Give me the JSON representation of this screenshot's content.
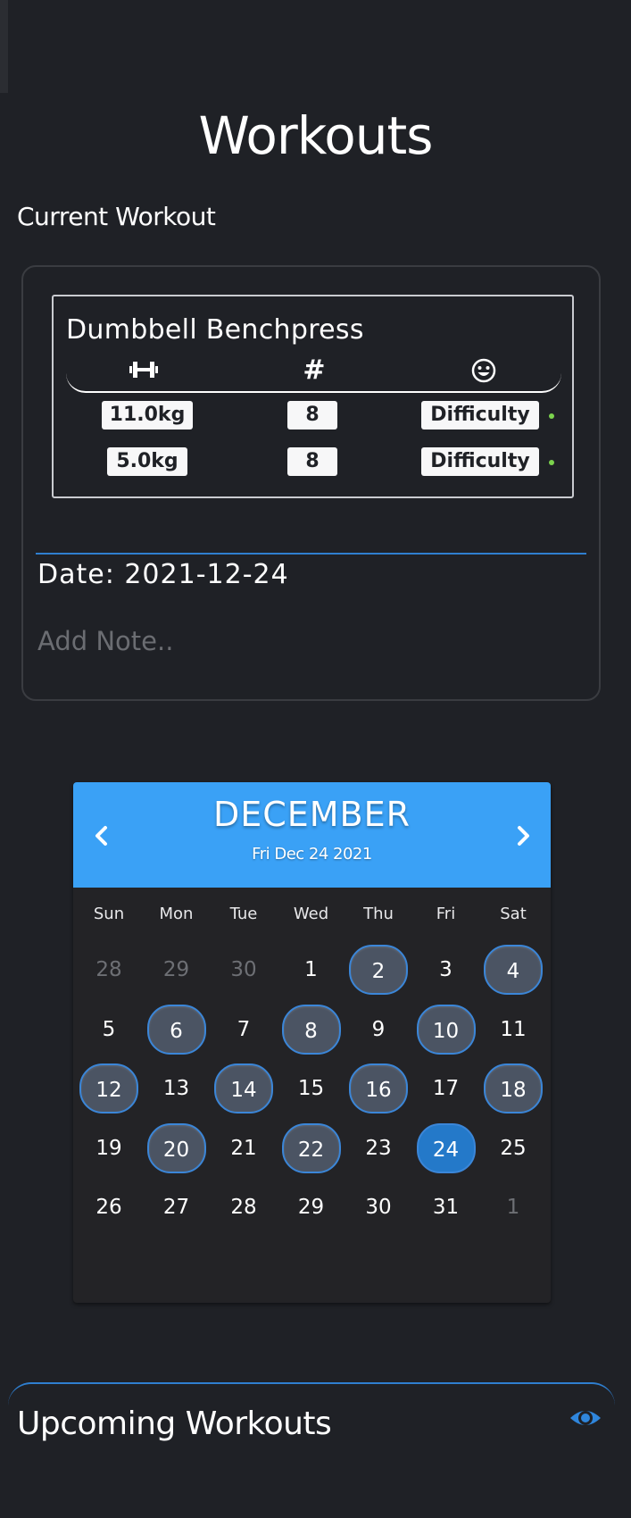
{
  "page": {
    "title": "Workouts"
  },
  "current_workout": {
    "section_label": "Current Workout",
    "exercise": {
      "name": "Dumbbell Benchpress",
      "columns": {
        "weight_icon": "dumbbell-icon",
        "reps_symbol": "#",
        "difficulty_icon": "smiley-icon"
      },
      "sets": [
        {
          "weight": "11.0kg",
          "reps": "8",
          "difficulty": "Difficulty"
        },
        {
          "weight": "5.0kg",
          "reps": "8",
          "difficulty": "Difficulty"
        }
      ]
    },
    "date_text": "Date: 2021-12-24",
    "note_placeholder": "Add Note.."
  },
  "calendar": {
    "month": "DECEMBER",
    "selected_label": "Fri Dec 24 2021",
    "weekdays": [
      "Sun",
      "Mon",
      "Tue",
      "Wed",
      "Thu",
      "Fri",
      "Sat"
    ],
    "weeks": [
      [
        "28",
        "29",
        "30",
        "1",
        "2",
        "3",
        "4"
      ],
      [
        "5",
        "6",
        "7",
        "8",
        "9",
        "10",
        "11"
      ],
      [
        "12",
        "13",
        "14",
        "15",
        "16",
        "17",
        "18"
      ],
      [
        "19",
        "20",
        "21",
        "22",
        "23",
        "24",
        "25"
      ],
      [
        "26",
        "27",
        "28",
        "29",
        "30",
        "31",
        "1"
      ]
    ],
    "other_month_cells": [
      "0-0",
      "0-1",
      "0-2",
      "4-6"
    ],
    "marked_days": [
      2,
      4,
      6,
      8,
      10,
      12,
      14,
      16,
      18,
      20,
      22
    ],
    "selected_day": 24
  },
  "upcoming": {
    "title": "Upcoming Workouts",
    "view_icon": "eye-icon"
  },
  "colors": {
    "background": "#1f2126",
    "accent": "#2f7fd0",
    "calendar_header": "#3aa1f6",
    "marked_day": "#4b5463",
    "selected_day": "#2479c9",
    "status_dot": "#7bd34d"
  }
}
